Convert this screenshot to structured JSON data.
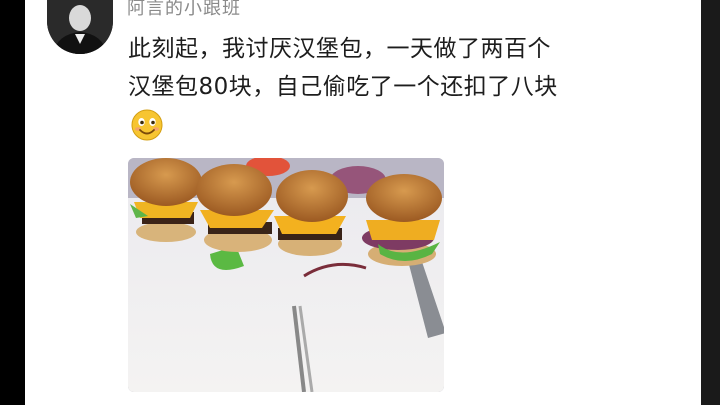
{
  "post": {
    "username": "阿言的小跟班",
    "text_line1": "此刻起，我讨厌汉堡包，一天做了两百个",
    "text_line2": "汉堡包80块，自己偷吃了一个还扣了八块",
    "emoji": "smile-emoji"
  },
  "photo": {
    "subject": "burgers on cutting board",
    "icon": "burger-photo"
  }
}
